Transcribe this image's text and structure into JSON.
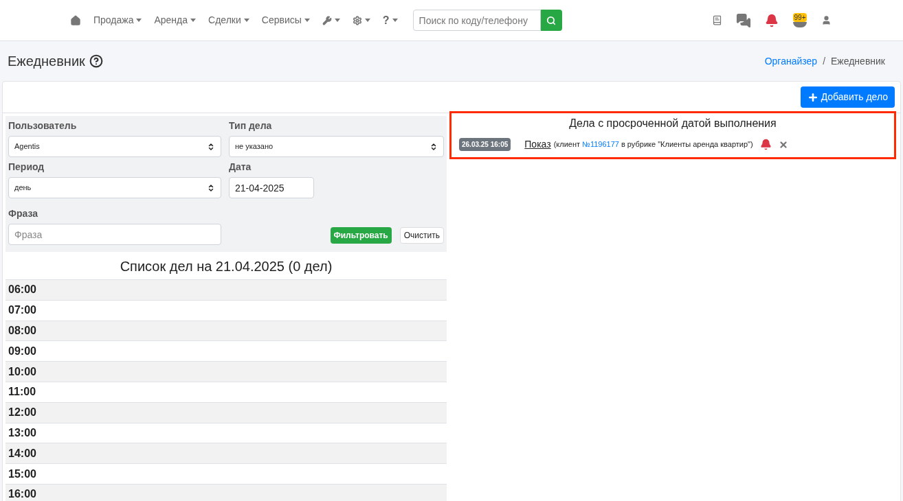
{
  "nav": {
    "menus": [
      {
        "label": "Продажа"
      },
      {
        "label": "Аренда"
      },
      {
        "label": "Сделки"
      },
      {
        "label": "Сервисы"
      }
    ],
    "help_label": "?",
    "search": {
      "placeholder": "Поиск по коду/телефону"
    },
    "badge": "99+"
  },
  "page": {
    "title": "Ежедневник",
    "breadcrumbs": [
      {
        "label": "Органайзер",
        "selected": false
      },
      {
        "label": "Ежедневник",
        "selected": true
      }
    ],
    "breadcrumb_separator": "/"
  },
  "add_button": "Добавить дело",
  "filters": {
    "user": {
      "label": "Пользователь",
      "value": "Agentis"
    },
    "type": {
      "label": "Тип дела",
      "value": "не указано"
    },
    "period": {
      "label": "Период",
      "value": "день"
    },
    "date": {
      "label": "Дата",
      "value": "21-04-2025"
    },
    "phrase": {
      "label": "Фраза",
      "placeholder": "Фраза"
    },
    "filter_button": "Фильтровать",
    "clear_button": "Очистить"
  },
  "schedule": {
    "title": "Список дел на 21.04.2025 (0 дел)",
    "hours": [
      "06:00",
      "07:00",
      "08:00",
      "09:00",
      "10:00",
      "11:00",
      "12:00",
      "13:00",
      "14:00",
      "15:00",
      "16:00"
    ]
  },
  "overdue": {
    "title": "Дела с просроченной датой выполнения",
    "items": [
      {
        "date": "26.03.25 16:05",
        "task": "Показ",
        "before": "(клиент",
        "client": "№1196177",
        "after": "в рубрике \"Клиенты аренда квартир\")"
      }
    ]
  }
}
